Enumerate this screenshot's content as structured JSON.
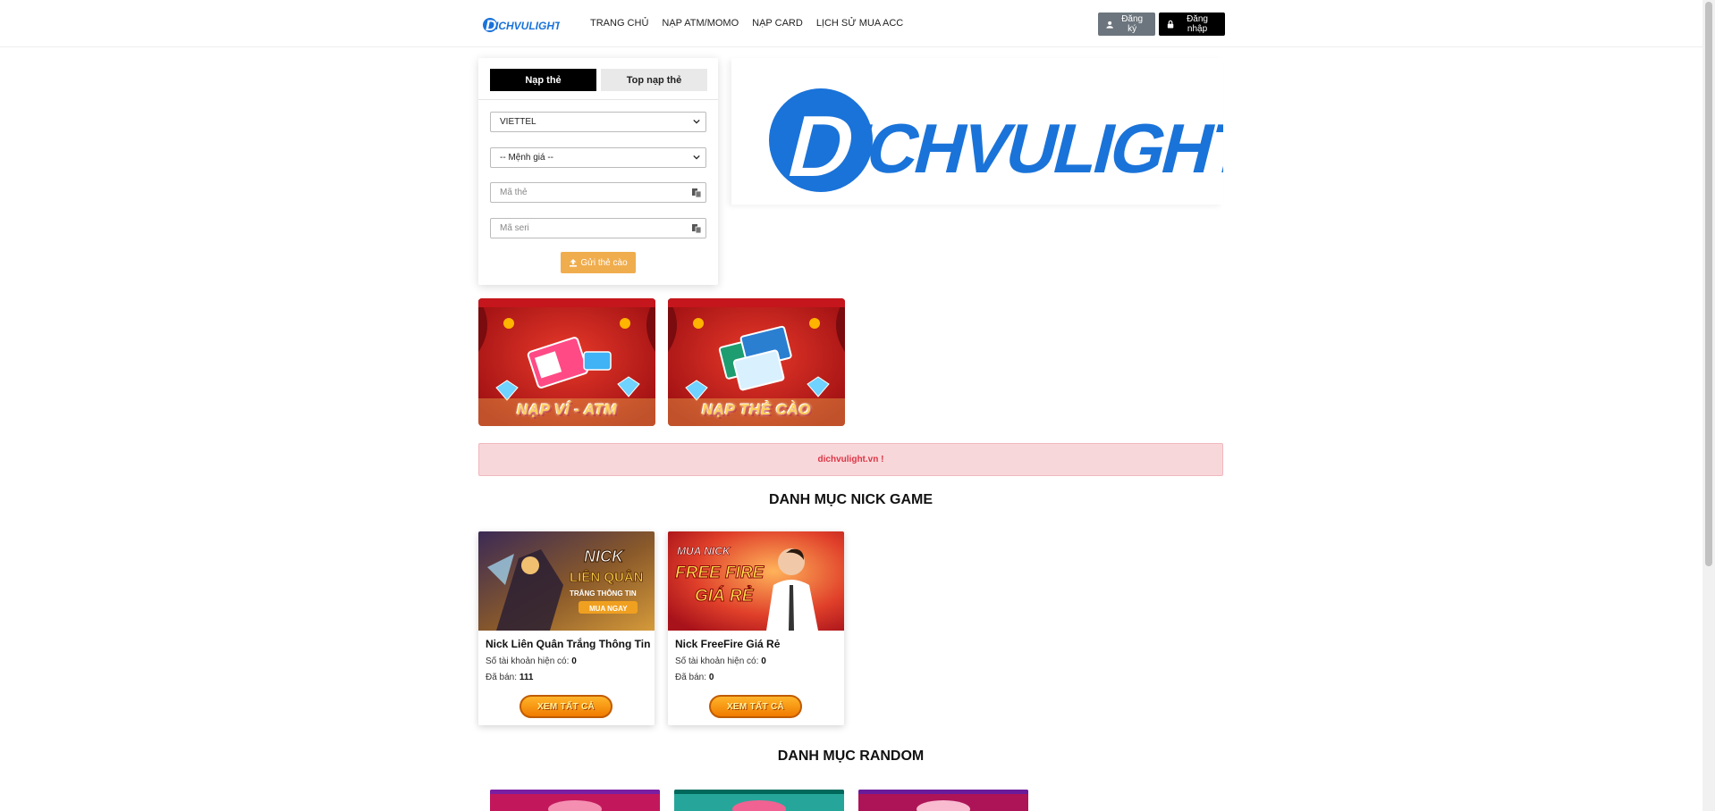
{
  "header": {
    "logo_text": "DICHVULIGHT.VN",
    "nav": [
      {
        "label": "TRANG CHỦ"
      },
      {
        "label": "NẠP ATM/MOMO"
      },
      {
        "label": "NẠP CARD"
      },
      {
        "label": "LỊCH SỬ MUA ACC"
      }
    ],
    "register_label": "Đăng ký",
    "login_label": "Đăng nhập"
  },
  "card_form": {
    "tabs": [
      {
        "label": "Nạp thẻ",
        "active": true
      },
      {
        "label": "Top nạp thẻ",
        "active": false
      }
    ],
    "telco_value": "VIETTEL",
    "amount_value": "-- Mệnh giá --",
    "card_code_placeholder": "Mã thẻ",
    "serial_placeholder": "Mã seri",
    "submit_label": "Gửi thẻ cào"
  },
  "hero": {
    "logo_text": "DICHVULIGHT.VN"
  },
  "promos": [
    {
      "caption": "NẠP VÍ - ATM"
    },
    {
      "caption": "NẠP THẺ CÀO"
    }
  ],
  "notice": {
    "text": "dichvulight.vn !"
  },
  "sections": {
    "nick_game_title": "DANH MỤC NICK GAME",
    "random_title": "DANH MỤC RANDOM"
  },
  "games": [
    {
      "title": "Nick Liên Quân Trắng Thông Tin",
      "accounts_label": "Số tài khoản hiện có:",
      "accounts_value": "0",
      "sold_label": "Đã bán:",
      "sold_value": "111",
      "button_label": "XEM TẤT CẢ",
      "thumb_text_1": "NICK",
      "thumb_text_2": "LIÊN QUÂN",
      "thumb_text_3": "TRẮNG THÔNG TIN",
      "thumb_text_4": "MUA NGAY"
    },
    {
      "title": "Nick FreeFire Giá Rẻ",
      "accounts_label": "Số tài khoản hiện có:",
      "accounts_value": "0",
      "sold_label": "Đã bán:",
      "sold_value": "0",
      "button_label": "XEM TẤT CẢ",
      "thumb_text_1": "MUA NICK",
      "thumb_text_2": "FREE FIRE",
      "thumb_text_3": "GIÁ RẺ"
    }
  ],
  "colors": {
    "accent_blue": "#1a73d9",
    "notice_bg": "#f8d7da",
    "notice_text": "#dc3545",
    "submit_orange": "#f0ad4e",
    "promo_red": "#c4161c"
  }
}
